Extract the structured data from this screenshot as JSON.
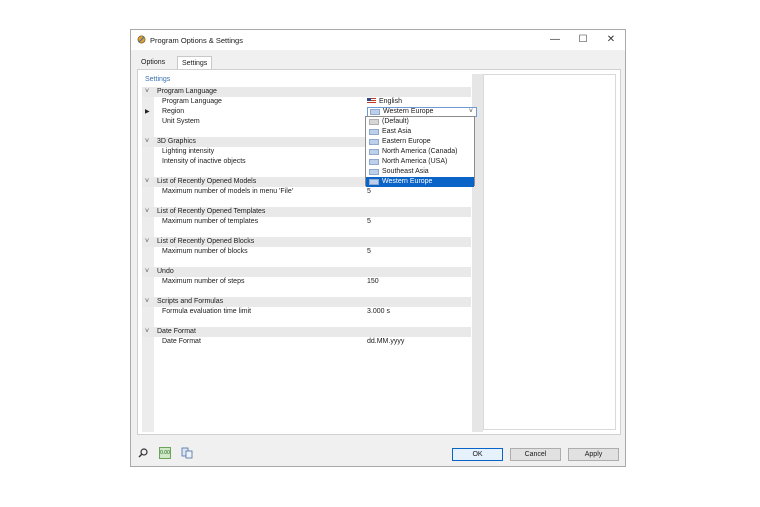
{
  "window": {
    "title": "Program Options & Settings",
    "controls": {
      "minimize": "—",
      "maximize": "☐",
      "close": "✕"
    }
  },
  "tabs": [
    {
      "label": "Options",
      "active": false
    },
    {
      "label": "Settings",
      "active": true
    }
  ],
  "panel_heading": "Settings",
  "sections": [
    {
      "title": "Program Language",
      "items": [
        {
          "label": "Program Language",
          "value": "English",
          "icon": "us-flag-icon"
        },
        {
          "label": "Region",
          "value": "Western Europe",
          "icon": "region-icon",
          "selected": true
        },
        {
          "label": "Unit System",
          "value": ""
        }
      ]
    },
    {
      "title": "3D Graphics",
      "items": [
        {
          "label": "Lighting intensity",
          "value": ""
        },
        {
          "label": "Intensity of inactive objects",
          "value": ""
        }
      ]
    },
    {
      "title": "List of Recently Opened Models",
      "items": [
        {
          "label": "Maximum number of models in menu 'File'",
          "value": "5"
        }
      ]
    },
    {
      "title": "List of Recently Opened Templates",
      "items": [
        {
          "label": "Maximum number of templates",
          "value": "5"
        }
      ]
    },
    {
      "title": "List of Recently Opened Blocks",
      "items": [
        {
          "label": "Maximum number of blocks",
          "value": "5"
        }
      ]
    },
    {
      "title": "Undo",
      "items": [
        {
          "label": "Maximum number of steps",
          "value": "150"
        }
      ]
    },
    {
      "title": "Scripts and Formulas",
      "items": [
        {
          "label": "Formula evaluation time limit",
          "value": "3.000 s"
        }
      ]
    },
    {
      "title": "Date Format",
      "items": [
        {
          "label": "Date Format",
          "value": "dd.MM.yyyy"
        }
      ]
    }
  ],
  "region_dropdown": {
    "options": [
      "(Default)",
      "East Asia",
      "Eastern Europe",
      "North America (Canada)",
      "North America (USA)",
      "Southeast Asia",
      "Western Europe"
    ],
    "selected": "Western Europe"
  },
  "footer": {
    "icons": [
      "search-icon",
      "decimal-format-icon",
      "export-icon"
    ],
    "decimal_icon_text": "0.00",
    "ok": "OK",
    "cancel": "Cancel",
    "apply": "Apply"
  },
  "colors": {
    "accent": "#0a64c8",
    "heading": "#3b6fb0"
  }
}
